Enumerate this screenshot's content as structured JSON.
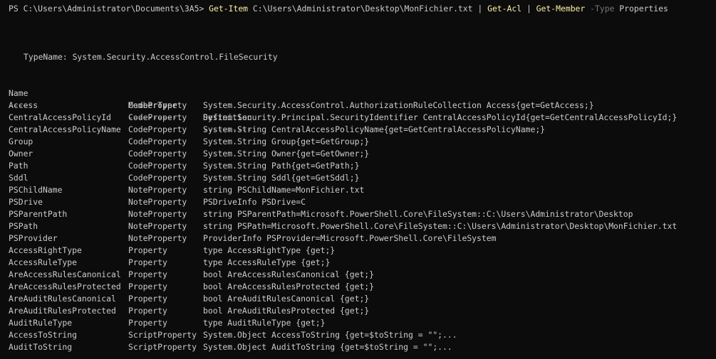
{
  "prompt": {
    "ps": "PS C:\\Users\\Administrator\\Documents\\3A5> ",
    "cmd1": "Get-Item",
    "arg1": " C:\\Users\\Administrator\\Desktop\\MonFichier.txt ",
    "pipe1": "|",
    "cmd2": " Get-Acl",
    "pipe2": " |",
    "cmd3": " Get-Member",
    "param": " -Type",
    "value": " Properties"
  },
  "typename": "TypeName: System.Security.AccessControl.FileSecurity",
  "headers": {
    "name": "Name",
    "membertype": "MemberType",
    "definition": "Definition"
  },
  "underlines": {
    "name": "----",
    "membertype": "----------",
    "definition": "----------"
  },
  "rows": [
    {
      "name": "Access",
      "type": "CodeProperty",
      "def": "System.Security.AccessControl.AuthorizationRuleCollection Access{get=GetAccess;}"
    },
    {
      "name": "CentralAccessPolicyId",
      "type": "CodeProperty",
      "def": "System.Security.Principal.SecurityIdentifier CentralAccessPolicyId{get=GetCentralAccessPolicyId;}"
    },
    {
      "name": "CentralAccessPolicyName",
      "type": "CodeProperty",
      "def": "System.String CentralAccessPolicyName{get=GetCentralAccessPolicyName;}"
    },
    {
      "name": "Group",
      "type": "CodeProperty",
      "def": "System.String Group{get=GetGroup;}"
    },
    {
      "name": "Owner",
      "type": "CodeProperty",
      "def": "System.String Owner{get=GetOwner;}"
    },
    {
      "name": "Path",
      "type": "CodeProperty",
      "def": "System.String Path{get=GetPath;}"
    },
    {
      "name": "Sddl",
      "type": "CodeProperty",
      "def": "System.String Sddl{get=GetSddl;}"
    },
    {
      "name": "PSChildName",
      "type": "NoteProperty",
      "def": "string PSChildName=MonFichier.txt"
    },
    {
      "name": "PSDrive",
      "type": "NoteProperty",
      "def": "PSDriveInfo PSDrive=C"
    },
    {
      "name": "PSParentPath",
      "type": "NoteProperty",
      "def": "string PSParentPath=Microsoft.PowerShell.Core\\FileSystem::C:\\Users\\Administrator\\Desktop"
    },
    {
      "name": "PSPath",
      "type": "NoteProperty",
      "def": "string PSPath=Microsoft.PowerShell.Core\\FileSystem::C:\\Users\\Administrator\\Desktop\\MonFichier.txt"
    },
    {
      "name": "PSProvider",
      "type": "NoteProperty",
      "def": "ProviderInfo PSProvider=Microsoft.PowerShell.Core\\FileSystem"
    },
    {
      "name": "AccessRightType",
      "type": "Property",
      "def": "type AccessRightType {get;}"
    },
    {
      "name": "AccessRuleType",
      "type": "Property",
      "def": "type AccessRuleType {get;}"
    },
    {
      "name": "AreAccessRulesCanonical",
      "type": "Property",
      "def": "bool AreAccessRulesCanonical {get;}"
    },
    {
      "name": "AreAccessRulesProtected",
      "type": "Property",
      "def": "bool AreAccessRulesProtected {get;}"
    },
    {
      "name": "AreAuditRulesCanonical",
      "type": "Property",
      "def": "bool AreAuditRulesCanonical {get;}"
    },
    {
      "name": "AreAuditRulesProtected",
      "type": "Property",
      "def": "bool AreAuditRulesProtected {get;}"
    },
    {
      "name": "AuditRuleType",
      "type": "Property",
      "def": "type AuditRuleType {get;}"
    },
    {
      "name": "AccessToString",
      "type": "ScriptProperty",
      "def": "System.Object AccessToString {get=$toString = \"\";..."
    },
    {
      "name": "AuditToString",
      "type": "ScriptProperty",
      "def": "System.Object AuditToString {get=$toString = \"\";..."
    }
  ],
  "colors": {
    "background": "#0c0c0c",
    "text": "#cccccc",
    "command": "#f9f1a5",
    "parameter": "#767676"
  }
}
